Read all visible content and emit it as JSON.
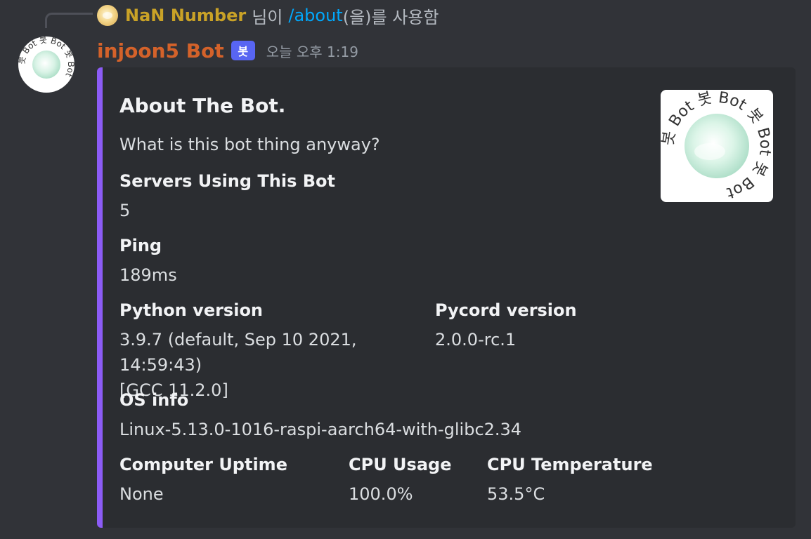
{
  "reply": {
    "username": "NaN Number",
    "text_before": "님이",
    "command": "/about",
    "text_after": "(을)를 사용함"
  },
  "message": {
    "bot_name": "injoon5 Bot",
    "bot_tag": "봇",
    "timestamp": "오늘 오후 1:19",
    "avatar_ring_text": "봇 Bot 봇 Bot 봇 Bot"
  },
  "embed": {
    "accent_color": "#8c5cf6",
    "title": "About The Bot.",
    "description": "What is this bot thing anyway?",
    "thumbnail_ring_text": "봇 Bot 봇 Bot 봇 Bot 봇 Bot",
    "fields": {
      "servers": {
        "name": "Servers Using This Bot",
        "value": "5"
      },
      "ping": {
        "name": "Ping",
        "value": "189ms"
      },
      "python": {
        "name": "Python version",
        "value_line1": "3.9.7 (default, Sep 10 2021, 14:59:43)",
        "value_line2": "[GCC 11.2.0]"
      },
      "pycord": {
        "name": "Pycord version",
        "value": "2.0.0-rc.1"
      },
      "os": {
        "name": "OS info",
        "value": "Linux-5.13.0-1016-raspi-aarch64-with-glibc2.34"
      },
      "uptime": {
        "name": "Computer Uptime",
        "value": "None"
      },
      "cpu_usage": {
        "name": "CPU Usage",
        "value": "100.0%"
      },
      "cpu_temp": {
        "name": "CPU Temperature",
        "value": "53.5°C"
      }
    }
  }
}
